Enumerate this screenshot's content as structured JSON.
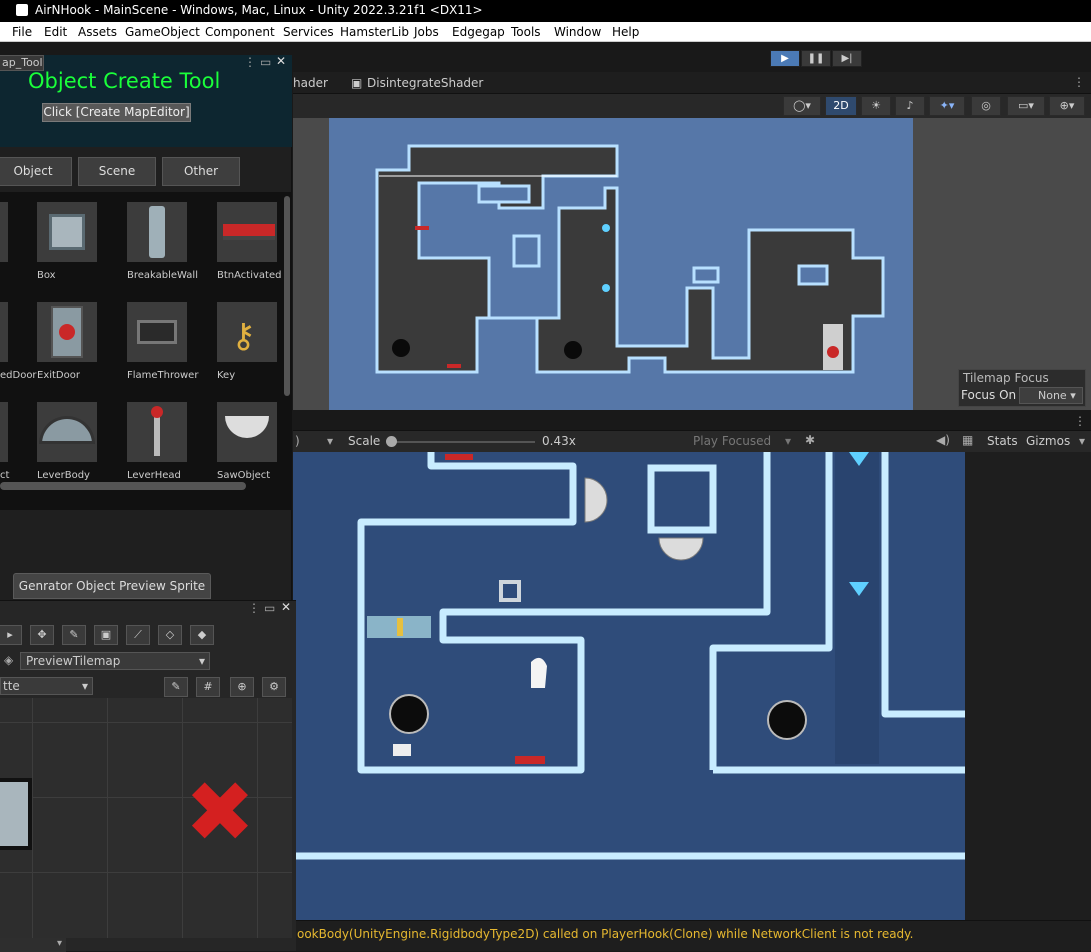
{
  "window": {
    "title": "AirNHook - MainScene - Windows, Mac, Linux - Unity 2022.3.21f1 <DX11>"
  },
  "menu": {
    "items": [
      "File",
      "Edit",
      "Assets",
      "GameObject",
      "Component",
      "Services",
      "HamsterLib",
      "Jobs",
      "Edgegap",
      "Tools",
      "Window",
      "Help"
    ]
  },
  "play_controls": {
    "play": "▶",
    "pause": "❚❚",
    "step": "▶|"
  },
  "object_tool": {
    "tab_label": "ap_Tool",
    "title": "Object Create Tool",
    "create_button": "Click [Create MapEditor]",
    "categories": [
      "Object",
      "Scene",
      "Other"
    ],
    "items": [
      {
        "label": "Box"
      },
      {
        "label": "BreakableWall"
      },
      {
        "label": "BtnActivated"
      },
      {
        "label": "edDoor"
      },
      {
        "label": "ExitDoor"
      },
      {
        "label": "FlameThrower"
      },
      {
        "label": "Key"
      },
      {
        "label": "ct"
      },
      {
        "label": "LeverBody"
      },
      {
        "label": "LeverHead"
      },
      {
        "label": "SawObject"
      }
    ],
    "preview_button": "Genrator Object Preview Sprite"
  },
  "palette": {
    "tilemap_label": "PreviewTilemap",
    "palette_label": "tte"
  },
  "scene_view": {
    "tabs": [
      "hader",
      "DisintegrateShader"
    ],
    "mode_2d": "2D",
    "tilemap_focus_title": "Tilemap Focus",
    "focus_on_label": "Focus On",
    "focus_on_value": "None"
  },
  "game_view": {
    "display_suffix": ")",
    "scale_label": "Scale",
    "scale_value": "0.43x",
    "play_focused": "Play Focused",
    "stats": "Stats",
    "gizmos": "Gizmos"
  },
  "console": {
    "message": "ookBody(UnityEngine.RigidbodyType2D) called on PlayerHook(Clone) while NetworkClient is not ready."
  },
  "colors": {
    "title_green": "#1aff3a",
    "warning": "#e6b830",
    "level_bg": "#2f4c7a",
    "accent": "#4b7ab5"
  }
}
